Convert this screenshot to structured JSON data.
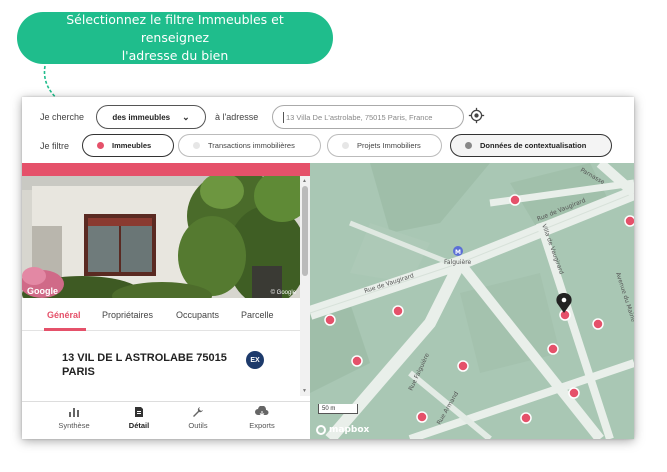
{
  "callout": {
    "line1": "Sélectionnez le filtre Immeubles et renseignez",
    "line2": "l'adresse du bien",
    "color": "#1fbd8c"
  },
  "search": {
    "label_je_cherche": "Je cherche",
    "select_value": "des immeubles",
    "label_adresse": "à l'adresse",
    "address_value": "13 Villa De L'astrolabe, 75015 Paris, France"
  },
  "filters": {
    "label": "Je filtre",
    "items": [
      {
        "label": "Immeubles",
        "active": true,
        "dot_color": "#e5516a"
      },
      {
        "label": "Transactions immobilières",
        "active": false,
        "dot_color": "#e6e6e6"
      },
      {
        "label": "Projets Immobiliers",
        "active": false,
        "dot_color": "#e6e6e6"
      },
      {
        "label": "Données de contextualisation",
        "active": true,
        "dot_color": "#888888"
      }
    ]
  },
  "photo": {
    "google_label": "Google",
    "copyright": "© Google"
  },
  "tabs": [
    {
      "label": "Général",
      "active": true
    },
    {
      "label": "Propriétaires",
      "active": false
    },
    {
      "label": "Occupants",
      "active": false
    },
    {
      "label": "Parcelle",
      "active": false
    }
  ],
  "property": {
    "address_line1": "13 VIL DE L ASTROLABE 75015",
    "address_line2": "PARIS",
    "badge": "EX"
  },
  "bottom_nav": [
    {
      "label": "Synthèse",
      "icon": "bar-chart-icon",
      "active": false
    },
    {
      "label": "Détail",
      "icon": "document-icon",
      "active": true
    },
    {
      "label": "Outils",
      "icon": "wrench-icon",
      "active": false
    },
    {
      "label": "Exports",
      "icon": "cloud-download-icon",
      "active": false
    }
  ],
  "map": {
    "streets": [
      "Rue de Vaugirard",
      "Rue de Vaugirard",
      "Rue Falguière",
      "Villa de Vaugirard",
      "Avenue du Maine",
      "Parnasse",
      "Rue Armand"
    ],
    "metro_station": "Falguière",
    "scale_label": "50 m",
    "provider": "mapbox",
    "marker_color": "#e5516a",
    "pin_color": "#222222"
  },
  "colors": {
    "accent": "#e5516a",
    "map_bg": "#a9c7b4"
  }
}
